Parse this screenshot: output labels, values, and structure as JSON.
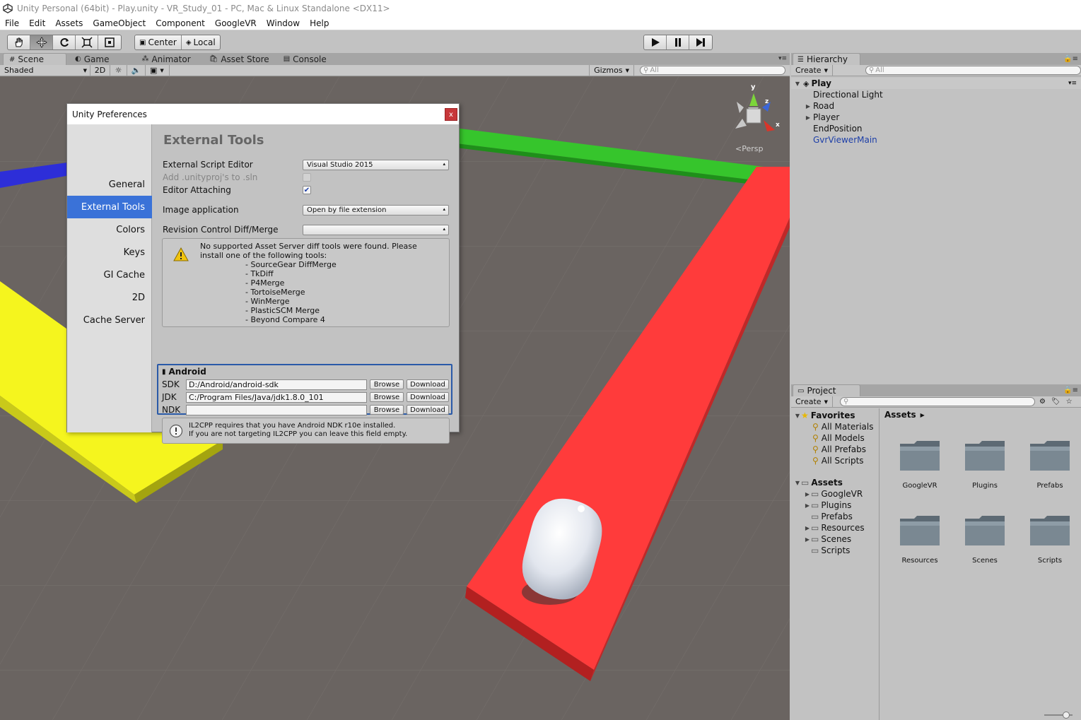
{
  "window": {
    "title": "Unity Personal (64bit) - Play.unity - VR_Study_01 - PC, Mac & Linux Standalone <DX11>"
  },
  "menu": [
    "File",
    "Edit",
    "Assets",
    "GameObject",
    "Component",
    "GoogleVR",
    "Window",
    "Help"
  ],
  "toolbar": {
    "pivot_label": "Center",
    "space_label": "Local"
  },
  "scene_tabs": {
    "scene": "Scene",
    "game": "Game",
    "animator": "Animator",
    "asset_store": "Asset Store",
    "console": "Console"
  },
  "scene_toolbar": {
    "shading_mode": "Shaded",
    "mode_2d": "2D",
    "gizmos": "Gizmos",
    "search_placeholder": "All"
  },
  "scene_gizmo": {
    "projection": "Persp",
    "axis_y": "y",
    "axis_z": "z",
    "axis_x": "x"
  },
  "hierarchy": {
    "tab_label": "Hierarchy",
    "create_label": "Create",
    "search_placeholder": "All",
    "scene_name": "Play",
    "items": [
      {
        "label": "Directional Light",
        "expandable": false
      },
      {
        "label": "Road",
        "expandable": true
      },
      {
        "label": "Player",
        "expandable": true
      },
      {
        "label": "EndPosition",
        "expandable": false
      },
      {
        "label": "GvrViewerMain",
        "expandable": false,
        "prefab": true
      }
    ]
  },
  "project": {
    "tab_label": "Project",
    "create_label": "Create",
    "favorites_label": "Favorites",
    "favorites": [
      "All Materials",
      "All Models",
      "All Prefabs",
      "All Scripts"
    ],
    "assets_label": "Assets",
    "asset_tree": [
      {
        "label": "GoogleVR",
        "expandable": true
      },
      {
        "label": "Plugins",
        "expandable": true
      },
      {
        "label": "Prefabs",
        "expandable": false
      },
      {
        "label": "Resources",
        "expandable": true
      },
      {
        "label": "Scenes",
        "expandable": true
      },
      {
        "label": "Scripts",
        "expandable": false
      }
    ],
    "breadcrumb": "Assets",
    "folders": [
      "GoogleVR",
      "Plugins",
      "Prefabs",
      "Resources",
      "Scenes",
      "Scripts"
    ]
  },
  "preferences": {
    "title": "Unity Preferences",
    "close_label": "x",
    "sections": [
      "General",
      "External Tools",
      "Colors",
      "Keys",
      "GI Cache",
      "2D",
      "Cache Server"
    ],
    "active_section": "External Tools",
    "heading": "External Tools",
    "rows": {
      "script_editor_label": "External Script Editor",
      "script_editor_value": "Visual Studio 2015",
      "add_unityproj_label": "Add .unityproj's to .sln",
      "editor_attaching_label": "Editor Attaching",
      "image_app_label": "Image application",
      "image_app_value": "Open by file extension",
      "revision_label": "Revision Control Diff/Merge",
      "revision_value": ""
    },
    "diff_warning": {
      "line1": "No supported Asset Server diff tools were found. Please",
      "line2": "install one of the following tools:",
      "tools": [
        "- SourceGear DiffMerge",
        "- TkDiff",
        "- P4Merge",
        "- TortoiseMerge",
        "- WinMerge",
        "- PlasticSCM Merge",
        "- Beyond Compare 4"
      ]
    },
    "android": {
      "heading": "Android",
      "sdk_label": "SDK",
      "sdk_path": "D:/Android/android-sdk",
      "jdk_label": "JDK",
      "jdk_path": "C:/Program Files/Java/jdk1.8.0_101",
      "ndk_label": "NDK",
      "ndk_path": "",
      "browse_label": "Browse",
      "download_label": "Download"
    },
    "il2cpp_note": {
      "line1": "IL2CPP requires that you have Android NDK r10e installed.",
      "line2": "If you are not targeting IL2CPP you can leave this field empty."
    }
  }
}
